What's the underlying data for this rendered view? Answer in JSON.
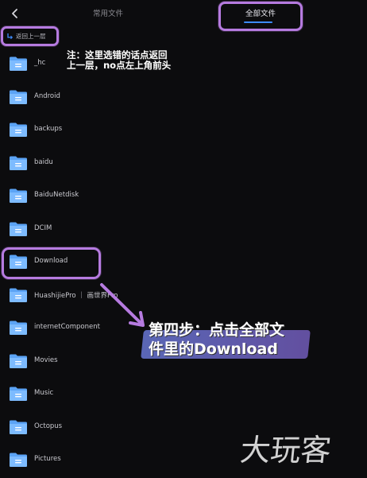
{
  "header": {
    "back_icon": "chevron-left-icon",
    "tabs": [
      {
        "label": "常用文件",
        "active": false
      },
      {
        "label": "全部文件",
        "active": true
      }
    ],
    "accent_color": "#3d8bff"
  },
  "up_level": {
    "label": "返回上一层",
    "icon": "return-arrow-icon"
  },
  "files": [
    {
      "name": "_hc"
    },
    {
      "name": "Android"
    },
    {
      "name": "backups"
    },
    {
      "name": "baidu"
    },
    {
      "name": "BaiduNetdisk"
    },
    {
      "name": "DCIM"
    },
    {
      "name": "Download"
    },
    {
      "name": "HuashijiePro ｜ 画世界Pro"
    },
    {
      "name": "internetComponent"
    },
    {
      "name": "Movies"
    },
    {
      "name": "Music"
    },
    {
      "name": "Octopus"
    },
    {
      "name": "Pictures"
    }
  ],
  "annotations": {
    "note_line1": "注：这里选错的话点返回",
    "note_line2": "上一层，no点左上角前头",
    "step_line1": "第四步：点击全部文",
    "step_line2": "件里的Download",
    "highlight_color": "#b67be0",
    "watermark": "大玩客"
  }
}
